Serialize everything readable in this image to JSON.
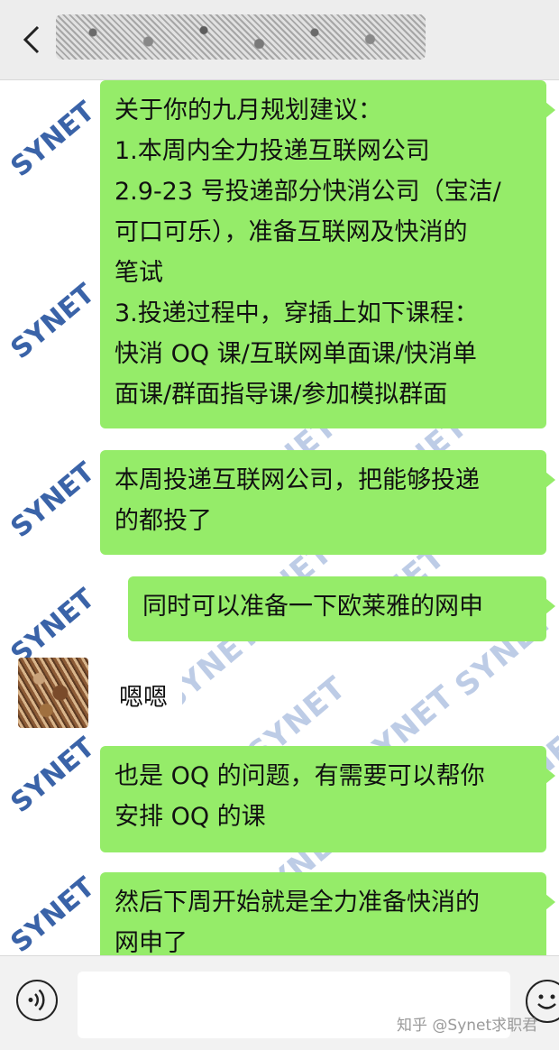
{
  "header": {
    "back_icon": "chevron-left-icon",
    "title": ""
  },
  "watermark": "SYNET",
  "messages": [
    {
      "sender": "advisor",
      "lines": [
        "关于你的九月规划建议：",
        "1.本周内全力投递互联网公司",
        "2.9-23 号投递部分快消公司（宝洁/",
        "可口可乐），准备互联网及快消的",
        "笔试",
        "3.投递过程中，穿插上如下课程：",
        "快消 OQ 课/互联网单面课/快消单",
        "面课/群面指导课/参加模拟群面"
      ]
    },
    {
      "sender": "advisor",
      "lines": [
        "本周投递互联网公司，把能够投递",
        "的都投了"
      ]
    },
    {
      "sender": "advisor",
      "lines": [
        "同时可以准备一下欧莱雅的网申"
      ]
    },
    {
      "sender": "user",
      "text": "嗯嗯"
    },
    {
      "sender": "advisor",
      "lines": [
        "也是 OQ 的问题，有需要可以帮你",
        "安排 OQ 的课"
      ]
    },
    {
      "sender": "advisor",
      "lines": [
        "然后下周开始就是全力准备快消的",
        "网申了"
      ]
    }
  ],
  "footer": {
    "voice_icon": "voice-icon",
    "emoji_icon": "emoji-icon",
    "input_value": "",
    "brand_text": "知乎 @Synet求职君"
  },
  "colors": {
    "bubble_green": "#95ec69",
    "watermark_blue": "#3a63a8",
    "header_bg": "#ededed"
  }
}
